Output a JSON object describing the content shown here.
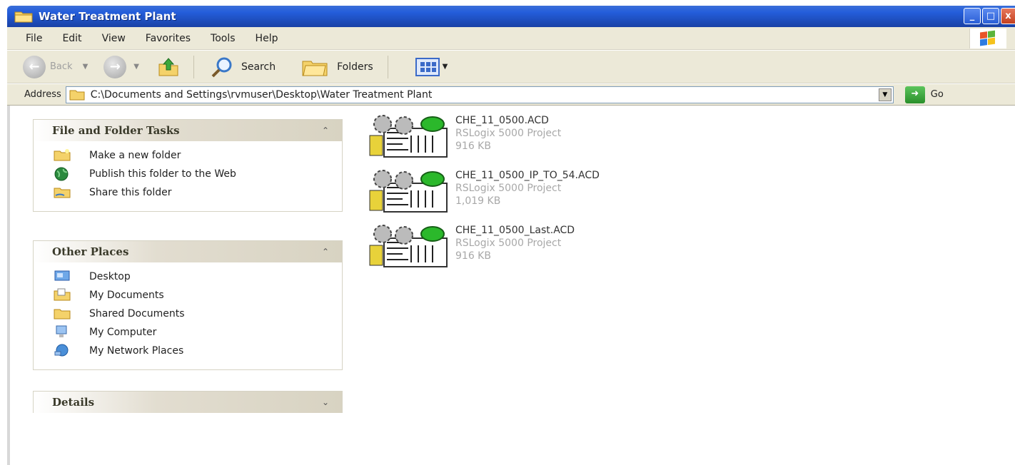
{
  "window": {
    "title": "Water Treatment Plant",
    "controls": {
      "minimize": "_",
      "maximize": "□",
      "close": "x"
    }
  },
  "menu": {
    "items": [
      {
        "label": "File",
        "mnemonic": "F"
      },
      {
        "label": "Edit",
        "mnemonic": "E"
      },
      {
        "label": "View",
        "mnemonic": "V"
      },
      {
        "label": "Favorites",
        "mnemonic": "a"
      },
      {
        "label": "Tools",
        "mnemonic": "T"
      },
      {
        "label": "Help",
        "mnemonic": "H"
      }
    ]
  },
  "toolbar": {
    "back_label": "Back",
    "search_label": "Search",
    "folders_label": "Folders"
  },
  "address": {
    "label": "Address",
    "value": "C:\\Documents and Settings\\rvmuser\\Desktop\\Water Treatment Plant",
    "go_label": "Go"
  },
  "task_pane": {
    "file_tasks": {
      "title": "File and Folder Tasks",
      "items": [
        {
          "label": "Make a new folder",
          "icon": "new-folder-icon"
        },
        {
          "label": "Publish this folder to the Web",
          "icon": "globe-icon"
        },
        {
          "label": "Share this folder",
          "icon": "share-folder-icon"
        }
      ]
    },
    "other_places": {
      "title": "Other Places",
      "items": [
        {
          "label": "Desktop",
          "icon": "desktop-icon"
        },
        {
          "label": "My Documents",
          "icon": "documents-folder-icon"
        },
        {
          "label": "Shared Documents",
          "icon": "shared-folder-icon"
        },
        {
          "label": "My Computer",
          "icon": "computer-icon"
        },
        {
          "label": "My Network Places",
          "icon": "network-icon"
        }
      ]
    },
    "details": {
      "title": "Details"
    }
  },
  "files": [
    {
      "name": "CHE_11_0500.ACD",
      "type": "RSLogix 5000 Project",
      "size": "916 KB"
    },
    {
      "name": "CHE_11_0500_IP_TO_54.ACD",
      "type": "RSLogix 5000 Project",
      "size": "1,019 KB"
    },
    {
      "name": "CHE_11_0500_Last.ACD",
      "type": "RSLogix 5000 Project",
      "size": "916 KB"
    }
  ],
  "colors": {
    "titlebar": "#245edb",
    "chrome": "#ece9d8",
    "accent_green": "#2a8f2a"
  }
}
